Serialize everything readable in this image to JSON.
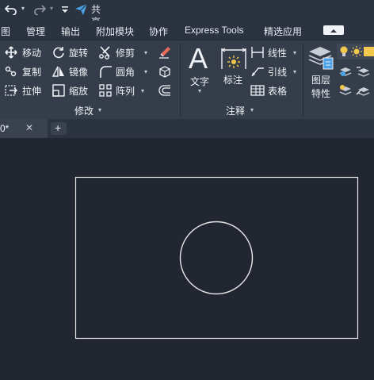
{
  "quick_access": {
    "share_label": "共享"
  },
  "menu": {
    "items": [
      "图",
      "管理",
      "输出",
      "附加模块",
      "协作",
      "Express Tools",
      "精选应用"
    ]
  },
  "ribbon": {
    "modify": {
      "move": "移动",
      "rotate": "旋转",
      "trim": "修剪",
      "copy": "复制",
      "mirror": "镜像",
      "fillet": "圆角",
      "stretch": "拉伸",
      "scale": "缩放",
      "array": "阵列",
      "title": "修改"
    },
    "annotation": {
      "text": "文字",
      "dimension": "标注",
      "linear": "线性",
      "leader": "引线",
      "table": "表格",
      "title": "注释"
    },
    "layers": {
      "layer_props_line1": "图层",
      "layer_props_line2": "特性"
    }
  },
  "tabs": {
    "doc_label": "0*",
    "close": "✕",
    "new": "+"
  },
  "colors": {
    "canvas_bg": "#212630",
    "ribbon_bg": "#353d4a",
    "menubar_bg": "#2b3340",
    "share_blue": "#4aa3e8",
    "drawing_stroke": "#e8e8e8"
  }
}
